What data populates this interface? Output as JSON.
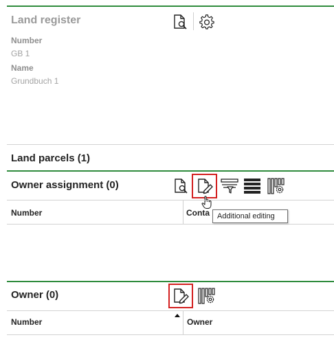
{
  "register": {
    "title": "Land register",
    "fields": [
      {
        "label": "Number",
        "value": "GB 1"
      },
      {
        "label": "Name",
        "value": "Grundbuch 1"
      }
    ],
    "icons": [
      "document-search-icon",
      "gear-icon"
    ]
  },
  "parcels": {
    "title": "Land parcels (1)"
  },
  "owner_assignment": {
    "title": "Owner assignment (0)",
    "icons": [
      "document-search-icon",
      "document-edit-icon",
      "filter-icon",
      "list-view-icon",
      "column-settings-icon"
    ],
    "columns": [
      "Number",
      "Conta"
    ],
    "tooltip": "Additional editing"
  },
  "owner": {
    "title": "Owner (0)",
    "icons": [
      "document-edit-icon",
      "column-settings-icon"
    ],
    "columns": [
      "Number",
      "Owner"
    ]
  },
  "colors": {
    "accent": "#2e8b3c",
    "highlight": "#d31f1f"
  }
}
